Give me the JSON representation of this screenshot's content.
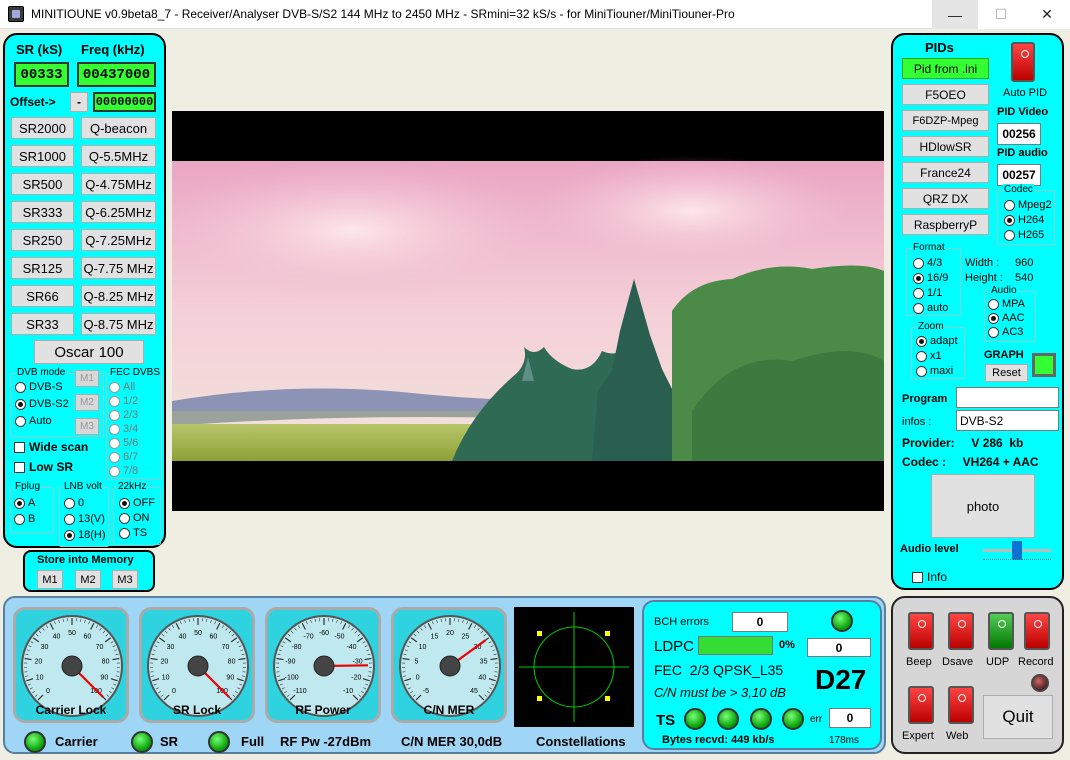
{
  "window": {
    "title": "MINITIOUNE v0.9beta8_7 - Receiver/Analyser DVB-S/S2 144 MHz to 2450 MHz - SRmini=32 kS/s - for MiniTiouner/MiniTiouner-Pro",
    "min": "—",
    "max": "☐",
    "close": "✕"
  },
  "left": {
    "sr_header": "SR (kS)",
    "freq_header": "Freq (kHz)",
    "sr_value": "00333",
    "freq_value": "00437000",
    "offset_label": "Offset->",
    "offset_sign": "-",
    "offset_value": "00000000",
    "sr_buttons": [
      "SR2000",
      "SR1000",
      "SR500",
      "SR333",
      "SR250",
      "SR125",
      "SR66",
      "SR33"
    ],
    "q_buttons": [
      "Q-beacon",
      "Q-5.5MHz",
      "Q-4.75MHz",
      "Q-6.25MHz",
      "Q-7.25MHz",
      "Q-7.75 MHz",
      "Q-8.25 MHz",
      "Q-8.75 MHz"
    ],
    "oscar": "Oscar 100",
    "dvb_mode": {
      "title": "DVB mode",
      "options": [
        "DVB-S",
        "DVB-S2",
        "Auto"
      ],
      "selected": "DVB-S2"
    },
    "m_small": [
      "M1",
      "M2",
      "M3"
    ],
    "fec": {
      "title": "FEC DVBS",
      "options": [
        "All",
        "1/2",
        "2/3",
        "3/4",
        "5/6",
        "6/7",
        "7/8"
      ]
    },
    "wide_scan": "Wide scan",
    "low_sr": "Low SR",
    "fplug": {
      "title": "Fplug",
      "options": [
        "A",
        "B"
      ],
      "selected": "A"
    },
    "lnb": {
      "title": "LNB volt",
      "options": [
        "0",
        "13(V)",
        "18(H)"
      ],
      "selected": "18(H)"
    },
    "khz22": {
      "title": "22kHz",
      "options": [
        "OFF",
        "ON",
        "TS"
      ],
      "selected": "OFF"
    },
    "store": {
      "title": "Store into Memory",
      "buttons": [
        "M1",
        "M2",
        "M3"
      ]
    }
  },
  "right": {
    "pids_title": "PIDs",
    "presets": [
      "Pid from .ini",
      "F5OEO",
      "F6DZP-Mpeg",
      "HDlowSR",
      "France24",
      "QRZ DX",
      "RaspberryP"
    ],
    "auto_pid": "Auto PID",
    "pid_video_label": "PID Video",
    "pid_video": "00256",
    "pid_audio_label": "PID audio",
    "pid_audio": "00257",
    "codec": {
      "title": "Codec",
      "options": [
        "Mpeg2",
        "H264",
        "H265"
      ],
      "selected": "H264"
    },
    "format": {
      "title": "Format",
      "options": [
        "4/3",
        "16/9",
        "1/1",
        "auto"
      ],
      "selected": "16/9"
    },
    "width_label": "Width :",
    "width_value": "960",
    "height_label": "Height :",
    "height_value": "540",
    "audio": {
      "title": "Audio",
      "options": [
        "MPA",
        "AAC",
        "AC3"
      ],
      "selected": "AAC"
    },
    "zoom": {
      "title": "Zoom",
      "options": [
        "adapt",
        "x1",
        "maxi"
      ],
      "selected": "adapt"
    },
    "graph_label": "GRAPH",
    "reset": "Reset",
    "program_label": "Program",
    "program_value": "",
    "infos_label": "infos :",
    "infos_value": "DVB-S2",
    "provider": "Provider:     V 286  kb",
    "codec_line": "Codec :     VH264 + AAC",
    "photo": "photo",
    "audio_level": "Audio level",
    "audio_level_value": 0.5,
    "info_label": "Info"
  },
  "switches": {
    "labels": [
      "Beep",
      "Dsave",
      "UDP",
      "Record",
      "Expert",
      "Web"
    ],
    "quit": "Quit"
  },
  "bottom": {
    "gauges": [
      {
        "label": "Carrier Lock",
        "ticks": [
          "0",
          "10",
          "20",
          "30",
          "40",
          "50",
          "60",
          "70",
          "80",
          "90",
          "100"
        ],
        "value": 100
      },
      {
        "label": "SR Lock",
        "ticks": [
          "0",
          "10",
          "20",
          "30",
          "40",
          "50",
          "60",
          "70",
          "80",
          "90",
          "100"
        ],
        "value": 100
      },
      {
        "label": "RF Power",
        "ticks": [
          "-110",
          "-100",
          "-90",
          "-80",
          "-70",
          "-60",
          "-50",
          "-40",
          "-30",
          "-20",
          "-10"
        ],
        "value": -27
      },
      {
        "label": "C/N MER",
        "ticks": [
          "-5",
          "0",
          "5",
          "10",
          "15",
          "20",
          "25",
          "30",
          "35",
          "40",
          "45"
        ],
        "value": 30
      }
    ],
    "carrier": "Carrier",
    "sr": "SR",
    "full": "Full",
    "rf_pw": "RF Pw  -27dBm",
    "cn_mer": "C/N MER 30,0dB",
    "constellations": "Constellations",
    "bch_label": "BCH errors",
    "bch_value": "0",
    "ldpc_label": "LDPC",
    "ldpc_pct": "0%",
    "ldpc_fill": 1.0,
    "ldpc_value": "0",
    "fec_line": "FEC  2/3 QPSK_L35",
    "cn_line": "C/N must be > 3,10 dB",
    "d27": "D27",
    "ts_label": "TS",
    "err_label": "err",
    "err_value": "0",
    "bytes": "Bytes recvd:  449 kb/s",
    "ms": "178ms"
  }
}
